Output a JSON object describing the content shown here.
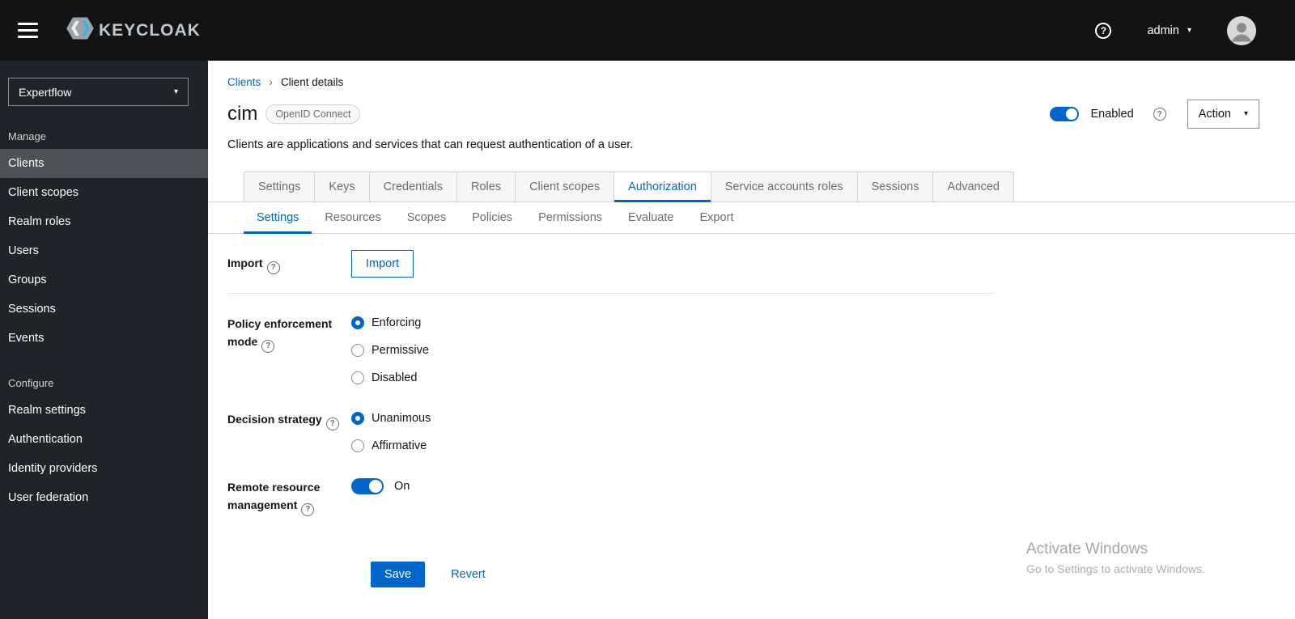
{
  "icons": {
    "help": "?",
    "caret_down": "▾",
    "breadcrumb_sep": "›"
  },
  "topbar": {
    "brand": "KEYCLOAK",
    "user": "admin"
  },
  "sidebar": {
    "realm": "Expertflow",
    "manage_label": "Manage",
    "manage_items": [
      "Clients",
      "Client scopes",
      "Realm roles",
      "Users",
      "Groups",
      "Sessions",
      "Events"
    ],
    "configure_label": "Configure",
    "configure_items": [
      "Realm settings",
      "Authentication",
      "Identity providers",
      "User federation"
    ]
  },
  "main": {
    "breadcrumb": {
      "parent": "Clients",
      "current": "Client details"
    },
    "client": {
      "name": "cim",
      "protocol_badge": "OpenID Connect",
      "description": "Clients are applications and services that can request authentication of a user.",
      "enabled_label": "Enabled",
      "action_label": "Action"
    },
    "tabs": [
      "Settings",
      "Keys",
      "Credentials",
      "Roles",
      "Client scopes",
      "Authorization",
      "Service accounts roles",
      "Sessions",
      "Advanced"
    ],
    "active_tab": "Authorization",
    "subtabs": [
      "Settings",
      "Resources",
      "Scopes",
      "Policies",
      "Permissions",
      "Evaluate",
      "Export"
    ],
    "active_subtab": "Settings",
    "form": {
      "import": {
        "label": "Import",
        "button": "Import"
      },
      "policy": {
        "label": "Policy enforcement mode",
        "options": [
          "Enforcing",
          "Permissive",
          "Disabled"
        ],
        "selected": "Enforcing"
      },
      "decision": {
        "label": "Decision strategy",
        "options": [
          "Unanimous",
          "Affirmative"
        ],
        "selected": "Unanimous"
      },
      "remote": {
        "label": "Remote resource management",
        "state_label": "On",
        "state": "on"
      },
      "save": "Save",
      "revert": "Revert"
    },
    "watermark": {
      "line1": "Activate Windows",
      "line2": "Go to Settings to activate Windows."
    }
  },
  "colors": {
    "accent_blue": "#0066cc",
    "topbar_bg": "#111315",
    "sidebar_bg": "#212427",
    "sidebar_active_bg": "#4f5255",
    "muted_text": "#6a6e73",
    "border": "#d2d2d2"
  }
}
